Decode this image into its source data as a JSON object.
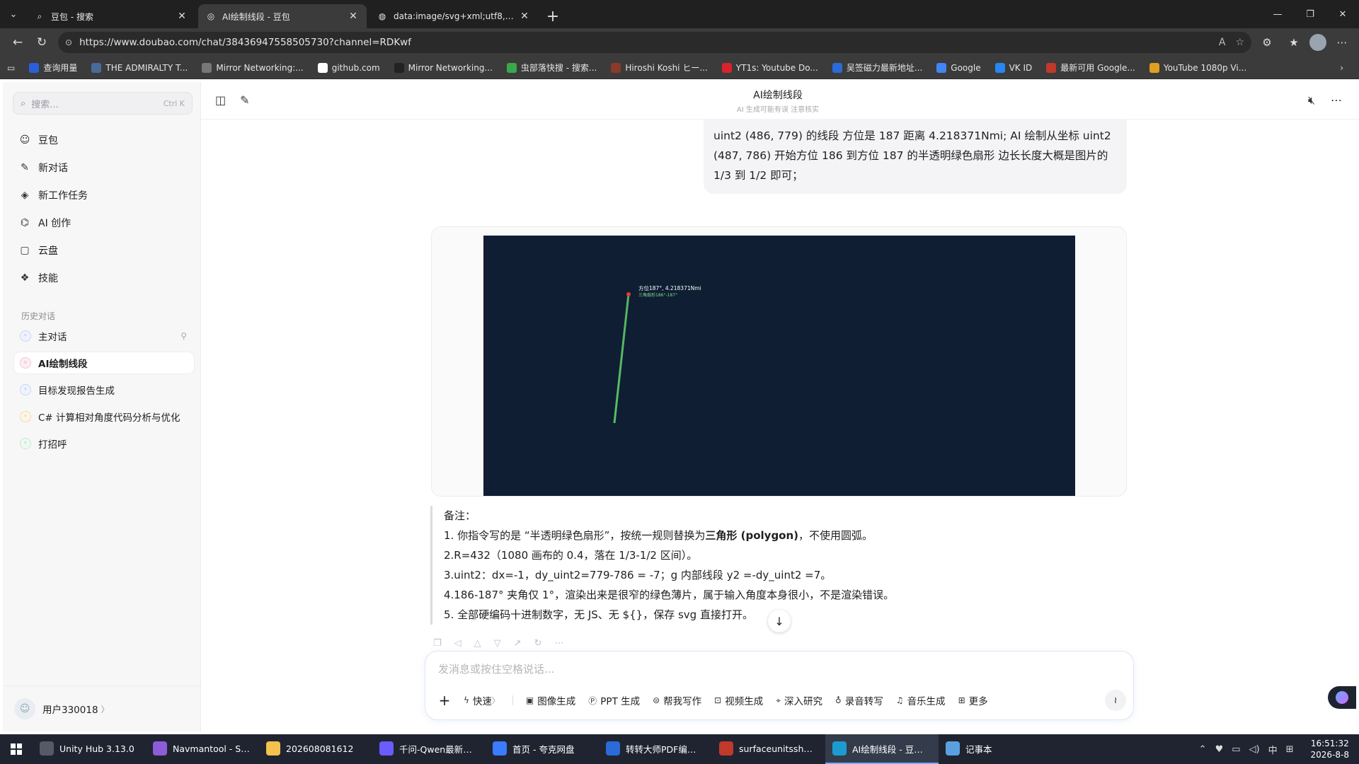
{
  "browser": {
    "tabs": [
      {
        "title": "豆包 - 搜索",
        "icon": "search-icon"
      },
      {
        "title": "AI绘制线段 - 豆包",
        "icon": "doubao-icon"
      },
      {
        "title": "data:image/svg+xml;utf8,<svg xmlns",
        "icon": "globe-icon"
      }
    ],
    "url": "https://www.doubao.com/chat/38436947558505730?channel=RDKwf",
    "bookmarks": [
      {
        "label": "查询用量",
        "color": "#2b5fd9"
      },
      {
        "label": "THE ADMIRALTY T...",
        "color": "#4a6a9a"
      },
      {
        "label": "Mirror Networking:...",
        "color": "#777777"
      },
      {
        "label": "github.com",
        "color": "#ffffff"
      },
      {
        "label": "Mirror Networking...",
        "color": "#222222"
      },
      {
        "label": "虫部落快搜 - 搜索...",
        "color": "#3aa84a"
      },
      {
        "label": "Hiroshi Koshi ヒー...",
        "color": "#8a3a2a"
      },
      {
        "label": "YT1s: Youtube Do...",
        "color": "#d9232a"
      },
      {
        "label": "吴签磁力最新地址...",
        "color": "#2a6ad9"
      },
      {
        "label": "Google",
        "color": "#4285f4"
      },
      {
        "label": "VK ID",
        "color": "#2787f5"
      },
      {
        "label": "最新可用 Google...",
        "color": "#c0392b"
      },
      {
        "label": "YouTube 1080p Vi...",
        "color": "#e0a020"
      }
    ]
  },
  "sidebar": {
    "search_placeholder": "搜索...",
    "search_shortcut": "Ctrl K",
    "nav": [
      {
        "label": "豆包",
        "icon": "doubao-avatar-icon"
      },
      {
        "label": "新对话",
        "icon": "new-chat-icon"
      },
      {
        "label": "新工作任务",
        "icon": "task-icon"
      },
      {
        "label": "AI 创作",
        "icon": "create-icon"
      },
      {
        "label": "云盘",
        "icon": "cloud-drive-icon"
      },
      {
        "label": "技能",
        "icon": "skills-icon"
      }
    ],
    "history_title": "历史对话",
    "history": [
      {
        "label": "主对话",
        "pinned": true
      },
      {
        "label": "AI绘制线段",
        "active": true
      },
      {
        "label": "目标发现报告生成"
      },
      {
        "label": "C# 计算相对角度代码分析与优化"
      },
      {
        "label": "打招呼"
      }
    ],
    "user": {
      "name": "用户330018",
      "chevron": "〉"
    }
  },
  "chat": {
    "title": "AI绘制线段",
    "subtitle": "AI 生成可能有误 注意核实",
    "user_message": "uint2 (486, 779) 的线段 方位是 187 距离 4.218371Nmi; AI 绘制从坐标 uint2 (487, 786) 开始方位 186 到方位 187 的半透明绿色扇形 边长长度大概是图片的 1/3 到 1/2 即可；",
    "image": {
      "background": "#0f1e33",
      "label_line1": "方位187°, 4.218371Nmi",
      "label_line2": "三角扇形186°-187°",
      "line_color": "#5fcf6a",
      "point_color": "#e03a3a"
    },
    "note": {
      "title": "备注：",
      "line1_pre": "1. 你指令写的是 “半透明绿色扇形”，按统一规则替换为",
      "line1_bold": "三角形 (polygon)",
      "line1_post": "，不使用圆弧。",
      "line2": "2.R=432（1080 画布的 0.4，落在 1/3-1/2 区间）。",
      "line3": "3.uint2：dx=-1，dy_uint2=779-786 = -7；g 内部线段 y2 =-dy_uint2 =7。",
      "line4": "4.186-187° 夹角仅 1°，渲染出来是很窄的绿色薄片，属于输入角度本身很小，不是渲染错误。",
      "line5": "5. 全部硬编码十进制数字，无 JS、无 ${}，保存 svg 直接打开。"
    },
    "composer": {
      "placeholder": "发消息或按住空格说话...",
      "tools": [
        "快速",
        "图像生成",
        "PPT 生成",
        "帮我写作",
        "视频生成",
        "深入研究",
        "录音转写",
        "音乐生成",
        "更多"
      ],
      "quick_suffix": "〉"
    }
  },
  "taskbar": {
    "items": [
      {
        "label": "Unity Hub 3.13.0",
        "color": "#555b66"
      },
      {
        "label": "Navmantool - Sta...",
        "color": "#8e5cd9"
      },
      {
        "label": "202608081612",
        "color": "#f2c14e"
      },
      {
        "label": "千问-Qwen最新模...",
        "color": "#6a5cff"
      },
      {
        "label": "首页 - 夸克网盘",
        "color": "#3a7bff"
      },
      {
        "label": "转转大师PDF编辑器",
        "color": "#2a6ad9"
      },
      {
        "label": "surfaceunitssheet...",
        "color": "#c0392b"
      },
      {
        "label": "AI绘制线段 - 豆包 ...",
        "color": "#1d9bd1",
        "active": true
      },
      {
        "label": "记事本",
        "color": "#5aa0e0"
      }
    ],
    "tray_lang": "中",
    "time": "16:51:32",
    "date": "2026-8-8"
  }
}
